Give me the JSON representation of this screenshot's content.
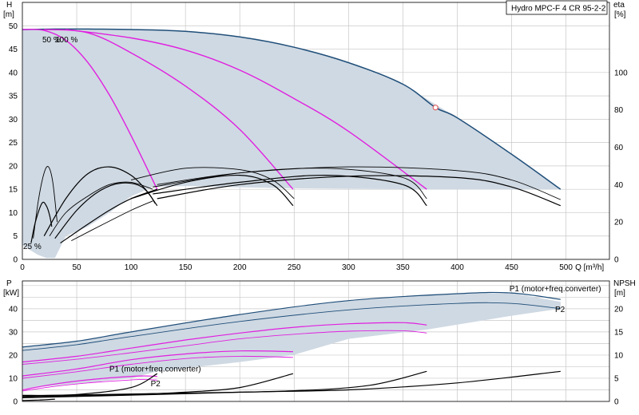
{
  "colors": {
    "envelope_fill": "#cfd9e3",
    "full_speed": "#1f4e79",
    "reduced_speed": "#e020e0",
    "efficiency": "#000000",
    "duty_point": "#e05050",
    "grid": "#c8c8c8"
  },
  "chart_data": [
    {
      "type": "line",
      "title": "Hydro MPC-F 4 CR 95-2-2",
      "xlabel": "Q [m³/h]",
      "ylabel": "H\n[m]",
      "y2label": "eta\n[%]",
      "xlim": [
        0,
        540
      ],
      "ylim": [
        0,
        55
      ],
      "y2lim": [
        0,
        137.5
      ],
      "grid": true,
      "xticks": [
        "0",
        "50",
        "100",
        "150",
        "200",
        "250",
        "300",
        "350",
        "400",
        "450",
        "500"
      ],
      "yticks": [
        "0",
        "5",
        "10",
        "15",
        "20",
        "25",
        "30",
        "35",
        "40",
        "45",
        "50"
      ],
      "y2ticks": [
        "0",
        "20",
        "40",
        "60",
        "80",
        "100"
      ],
      "annotations": [
        "50 %",
        "100 %",
        "25 %"
      ],
      "duty_point": {
        "x": 380,
        "y": 32.5
      },
      "envelope": [
        [
          0,
          49.2
        ],
        [
          20,
          49.3
        ],
        [
          60,
          49.3
        ],
        [
          100,
          49.2
        ],
        [
          150,
          48.8
        ],
        [
          200,
          47.6
        ],
        [
          250,
          45.4
        ],
        [
          300,
          42.1
        ],
        [
          350,
          37.5
        ],
        [
          400,
          30.3
        ],
        [
          450,
          22.5
        ],
        [
          495,
          15.0
        ],
        [
          360,
          15.0
        ],
        [
          250,
          15.2
        ],
        [
          200,
          15.4
        ],
        [
          150,
          15.7
        ],
        [
          120,
          15.5
        ],
        [
          100,
          13.5
        ],
        [
          80,
          10.0
        ],
        [
          60,
          7.0
        ],
        [
          40,
          5.0
        ],
        [
          30,
          0.3
        ],
        [
          22,
          0.3
        ],
        [
          14,
          1.0
        ],
        [
          0,
          3.0
        ],
        [
          0,
          49.2
        ]
      ],
      "series": [
        {
          "kind": "head",
          "color": "full_speed",
          "x": [
            0,
            30,
            60,
            100,
            150,
            200,
            250,
            300,
            350,
            380,
            400,
            450,
            495
          ],
          "y": [
            49.2,
            49.3,
            49.3,
            49.2,
            48.8,
            47.6,
            45.4,
            42.1,
            37.5,
            32.5,
            30.3,
            22.5,
            15.0
          ]
        },
        {
          "kind": "head",
          "color": "reduced_speed",
          "x": [
            0,
            20,
            40,
            60,
            80,
            100,
            124
          ],
          "y": [
            49.2,
            49.0,
            46.9,
            42.2,
            35.2,
            26.5,
            15.0
          ]
        },
        {
          "kind": "head",
          "color": "reduced_speed",
          "x": [
            20,
            60,
            100,
            150,
            200,
            249
          ],
          "y": [
            49.2,
            48.5,
            44.2,
            37.1,
            27.8,
            15.0
          ]
        },
        {
          "kind": "head",
          "color": "reduced_speed",
          "x": [
            40,
            100,
            150,
            200,
            250,
            300,
            372
          ],
          "y": [
            49.2,
            47.4,
            44.8,
            40.5,
            34.4,
            27.4,
            15.0
          ]
        },
        {
          "kind": "efficiency",
          "width": 0.9,
          "x": [
            10,
            15,
            20,
            24,
            28,
            32
          ],
          "y": [
            4.5,
            13.0,
            18.5,
            19.8,
            16.5,
            8.0
          ]
        },
        {
          "kind": "efficiency",
          "width": 1.2,
          "x": [
            8,
            12,
            18,
            22,
            25,
            27
          ],
          "y": [
            3.5,
            8.0,
            12.0,
            11.5,
            9.5,
            7.0
          ]
        },
        {
          "kind": "efficiency",
          "width": 1.2,
          "x": [
            20,
            40,
            60,
            80,
            100,
            115,
            122
          ],
          "y": [
            5.0,
            13.0,
            18.3,
            19.8,
            18.0,
            14.5,
            12.0
          ]
        },
        {
          "kind": "efficiency",
          "width": 1.2,
          "x": [
            30,
            50,
            70,
            90,
            110,
            124
          ],
          "y": [
            4.5,
            10.5,
            14.5,
            16.3,
            15.5,
            11.5
          ]
        },
        {
          "kind": "efficiency",
          "width": 0.9,
          "x": [
            25,
            40,
            60,
            80,
            100,
            120
          ],
          "y": [
            5.0,
            10.0,
            13.5,
            16.0,
            16.5,
            15.0
          ]
        },
        {
          "kind": "efficiency",
          "width": 1.2,
          "x": [
            35,
            60,
            80,
            100,
            124
          ],
          "y": [
            3.5,
            7.5,
            10.5,
            13.0,
            15.0
          ]
        },
        {
          "kind": "efficiency",
          "width": 0.9,
          "x": [
            45,
            70,
            100,
            120
          ],
          "y": [
            4.0,
            7.0,
            10.5,
            12.5
          ]
        },
        {
          "kind": "efficiency",
          "width": 0.9,
          "x": [
            100,
            150,
            200,
            230,
            250
          ],
          "y": [
            17.0,
            19.5,
            19.2,
            17.0,
            13.0
          ]
        },
        {
          "kind": "efficiency",
          "width": 1.2,
          "x": [
            100,
            150,
            200,
            230,
            249
          ],
          "y": [
            13.0,
            16.5,
            18.0,
            16.0,
            11.5
          ]
        },
        {
          "kind": "efficiency",
          "width": 0.9,
          "x": [
            120,
            200,
            280,
            350,
            372
          ],
          "y": [
            15.5,
            18.5,
            19.5,
            17.5,
            13.0
          ]
        },
        {
          "kind": "efficiency",
          "width": 1.2,
          "x": [
            120,
            200,
            280,
            350,
            372
          ],
          "y": [
            14.0,
            16.5,
            18.0,
            16.0,
            11.5
          ]
        },
        {
          "kind": "efficiency",
          "width": 0.9,
          "x": [
            124,
            200,
            300,
            400,
            450,
            495
          ],
          "y": [
            16.0,
            18.5,
            19.8,
            19.0,
            17.0,
            12.8
          ]
        },
        {
          "kind": "efficiency",
          "width": 1.2,
          "x": [
            124,
            200,
            300,
            400,
            450,
            495
          ],
          "y": [
            13.0,
            16.0,
            17.8,
            17.5,
            15.5,
            11.5
          ]
        }
      ]
    },
    {
      "type": "line",
      "xlabel": "",
      "ylabel": "P\n[kW]",
      "y2label": "NPSH\n[m]",
      "xlim": [
        0,
        540
      ],
      "ylim": [
        0,
        52
      ],
      "y2lim": [
        0,
        26
      ],
      "grid": true,
      "yticks": [
        "0",
        "10",
        "20",
        "30",
        "40"
      ],
      "y2ticks": [
        "0",
        "5",
        "10",
        "15",
        "20"
      ],
      "series_labels": [
        {
          "text": "P1 (motor+freq.converter)",
          "x": 448,
          "y": 47.5,
          "color": "full_speed"
        },
        {
          "text": "P2",
          "x": 490,
          "y": 38.5,
          "color": "full_speed"
        },
        {
          "text": "P1 (motor+freq.converter)",
          "x": 80,
          "y": 13.0,
          "color": "full_speed"
        },
        {
          "text": "P2",
          "x": 118,
          "y": 6.5,
          "color": "full_speed"
        }
      ],
      "envelope": [
        [
          0,
          23.5
        ],
        [
          50,
          26.0
        ],
        [
          100,
          30.0
        ],
        [
          200,
          37.5
        ],
        [
          300,
          43.5
        ],
        [
          400,
          46.5
        ],
        [
          450,
          46.8
        ],
        [
          495,
          43.0
        ],
        [
          495,
          40.0
        ],
        [
          450,
          37.0
        ],
        [
          372,
          31.0
        ],
        [
          300,
          27.0
        ],
        [
          249,
          20.0
        ],
        [
          200,
          17.0
        ],
        [
          124,
          13.0
        ],
        [
          100,
          10.0
        ],
        [
          0,
          5.5
        ],
        [
          0,
          23.5
        ]
      ],
      "series": [
        {
          "kind": "power",
          "color": "full_speed",
          "width": 1.2,
          "x": [
            0,
            50,
            100,
            200,
            300,
            400,
            450,
            495
          ],
          "y": [
            23.5,
            26.0,
            30.0,
            37.5,
            43.5,
            46.5,
            46.8,
            44.0
          ]
        },
        {
          "kind": "power",
          "color": "full_speed",
          "width": 0.9,
          "x": [
            0,
            50,
            100,
            200,
            300,
            400,
            450,
            495
          ],
          "y": [
            22.0,
            24.5,
            28.0,
            34.5,
            39.5,
            42.3,
            42.3,
            40.0
          ]
        },
        {
          "kind": "power",
          "color": "reduced_speed",
          "width": 1.2,
          "x": [
            0,
            50,
            100,
            150,
            200,
            250,
            300,
            350,
            372
          ],
          "y": [
            17.0,
            19.5,
            23.0,
            26.5,
            29.5,
            32.0,
            33.5,
            34.0,
            33.0
          ]
        },
        {
          "kind": "power",
          "color": "reduced_speed",
          "width": 0.9,
          "x": [
            0,
            50,
            100,
            150,
            200,
            250,
            300,
            350,
            372
          ],
          "y": [
            16.0,
            18.2,
            21.0,
            24.0,
            27.0,
            29.0,
            30.3,
            30.5,
            29.5
          ]
        },
        {
          "kind": "power",
          "color": "reduced_speed",
          "width": 1.2,
          "x": [
            0,
            50,
            100,
            150,
            200,
            249
          ],
          "y": [
            11.0,
            14.0,
            18.0,
            20.5,
            21.8,
            21.5
          ]
        },
        {
          "kind": "power",
          "color": "reduced_speed",
          "width": 0.9,
          "x": [
            0,
            50,
            100,
            150,
            200,
            249
          ],
          "y": [
            10.0,
            12.8,
            16.0,
            18.5,
            19.5,
            19.0
          ]
        },
        {
          "kind": "power",
          "color": "reduced_speed",
          "width": 1.2,
          "x": [
            0,
            30,
            60,
            90,
            110,
            124
          ],
          "y": [
            5.0,
            7.5,
            9.3,
            10.5,
            11.0,
            10.8
          ]
        },
        {
          "kind": "power",
          "color": "reduced_speed",
          "width": 0.9,
          "x": [
            0,
            30,
            60,
            90,
            110,
            124
          ],
          "y": [
            4.5,
            6.5,
            8.0,
            9.0,
            9.5,
            9.2
          ]
        },
        {
          "kind": "npsh",
          "color": "efficiency",
          "width": 1.2,
          "x": [
            0,
            124,
            200,
            300,
            400,
            495
          ],
          "y2": [
            0.8,
            1.5,
            2.0,
            2.5,
            4.0,
            6.5
          ]
        },
        {
          "kind": "npsh",
          "color": "efficiency",
          "width": 1.2,
          "x": [
            0,
            100,
            150,
            200,
            249
          ],
          "y2": [
            1.0,
            1.5,
            2.0,
            3.0,
            6.0
          ]
        },
        {
          "kind": "npsh",
          "color": "efficiency",
          "width": 1.2,
          "x": [
            0,
            150,
            250,
            320,
            372
          ],
          "y2": [
            1.2,
            1.8,
            2.3,
            3.5,
            6.5
          ]
        },
        {
          "kind": "npsh",
          "color": "efficiency",
          "width": 1.2,
          "x": [
            0,
            50,
            100,
            124
          ],
          "y2": [
            1.3,
            1.5,
            3.0,
            6.0
          ]
        },
        {
          "kind": "npsh",
          "color": "efficiency",
          "width": 1.2,
          "x": [
            0,
            15,
            30
          ],
          "y2": [
            0.2,
            0.3,
            0.5
          ]
        }
      ]
    }
  ]
}
